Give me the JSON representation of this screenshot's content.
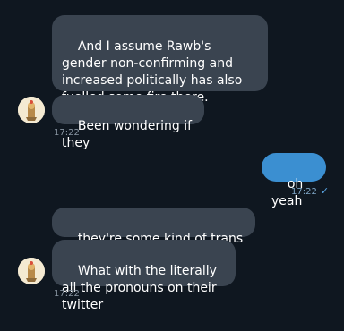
{
  "colors": {
    "background": "#0f1720",
    "incoming_bubble": "#3a4450",
    "outgoing_bubble": "#3b8fd1",
    "timestamp": "#8a96a3",
    "read_check": "#5aa7e6"
  },
  "messages": [
    {
      "text": "And I assume Rawb's gender non-confirming and increased politically has also fuelled some fire there."
    },
    {
      "text": "Been wondering if they"
    },
    {
      "time": "17:22"
    },
    {
      "text": "oh yeah",
      "time": "17:22",
      "status_icon": "double-check-icon"
    },
    {
      "text": "they're some kind of trans lately"
    },
    {
      "text": "What with the literally all the pronouns on their twitter"
    },
    {
      "time": "17:22"
    }
  ]
}
